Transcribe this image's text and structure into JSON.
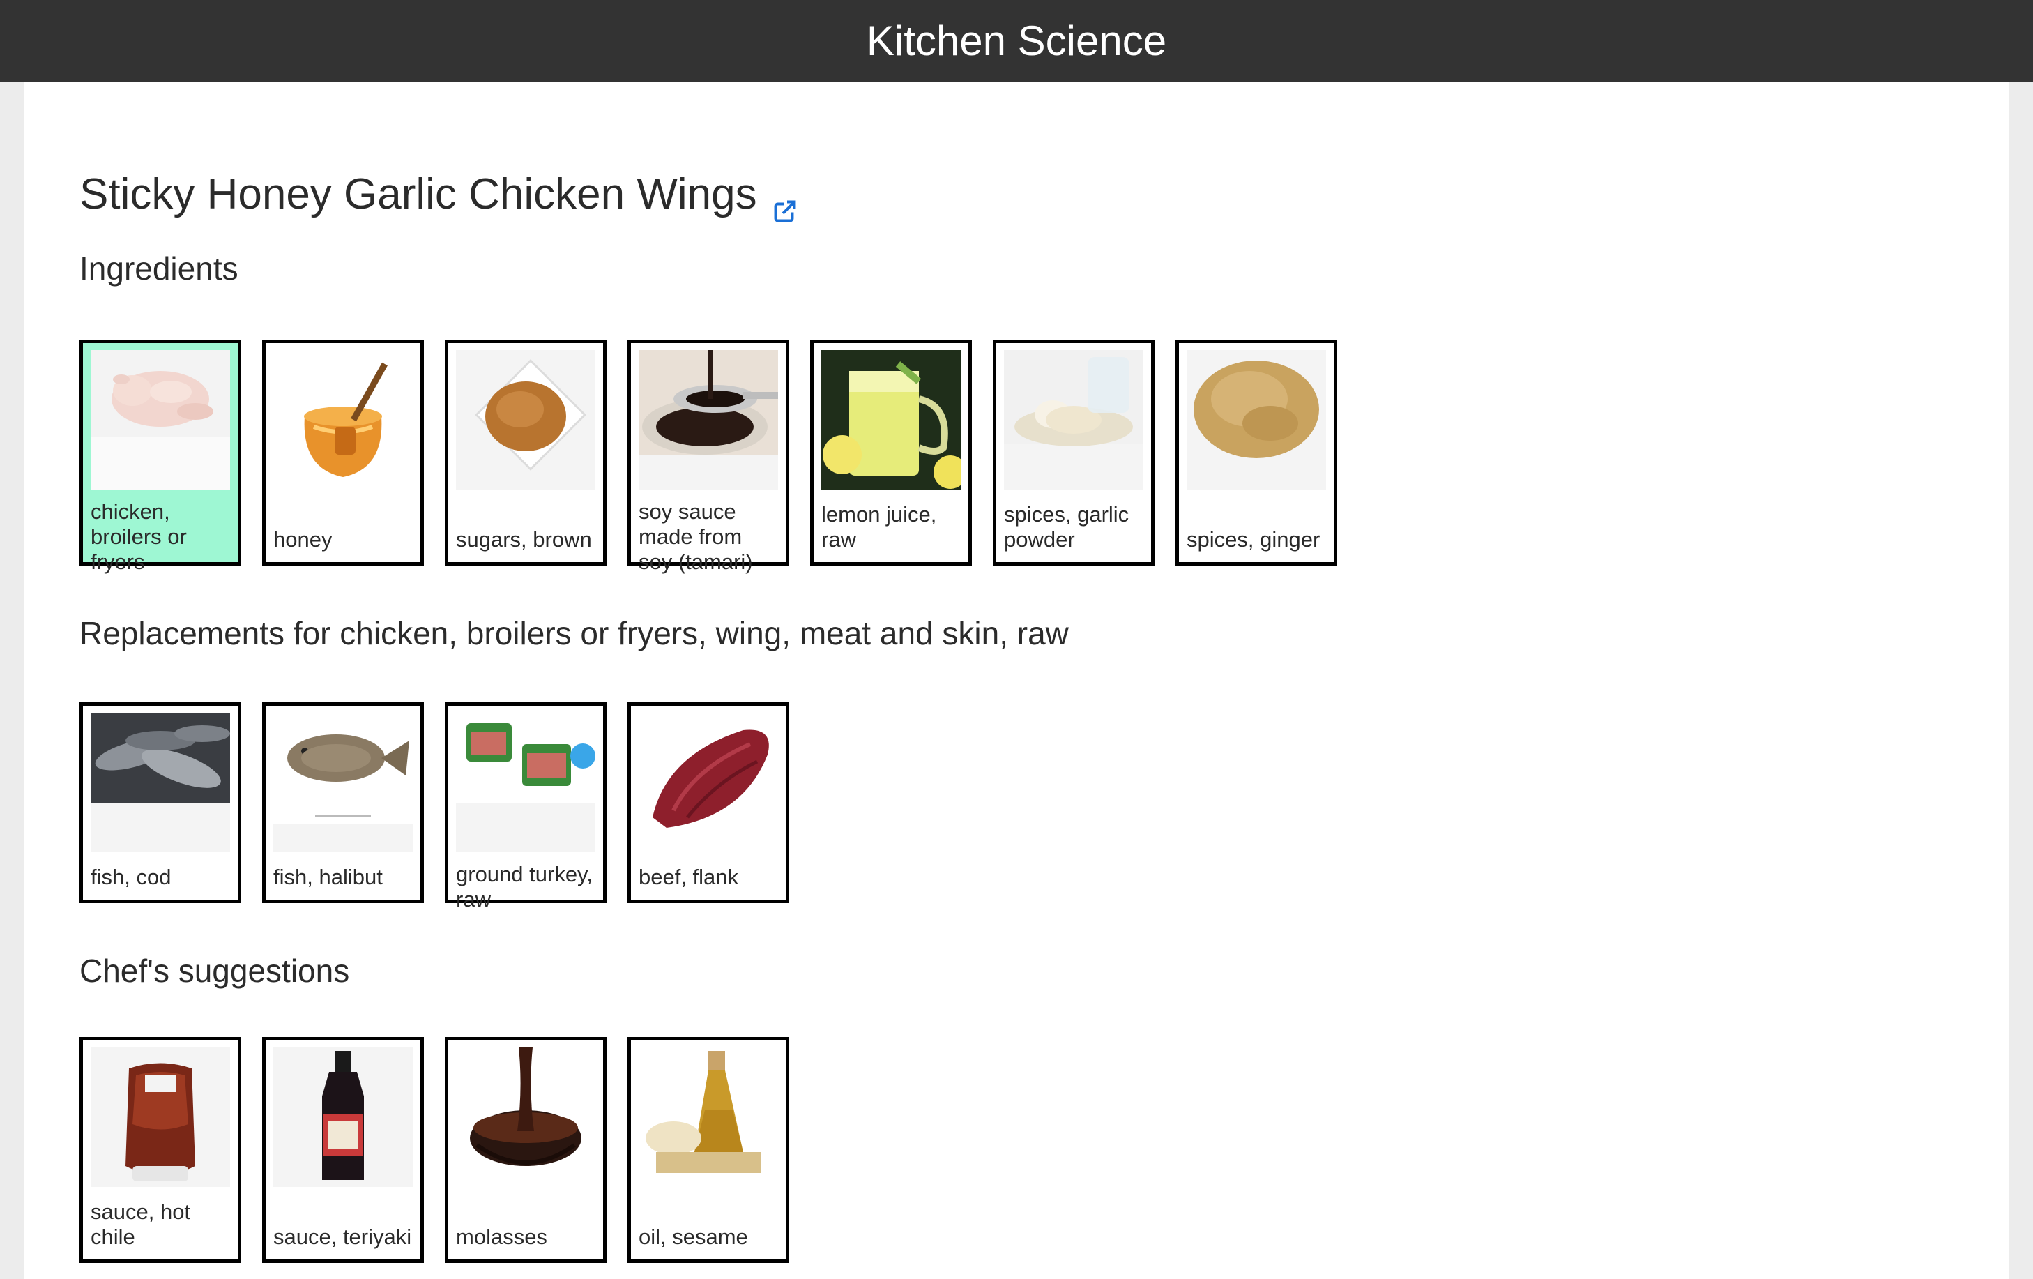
{
  "app": {
    "title": "Kitchen Science"
  },
  "recipe": {
    "title": "Sticky Honey Garlic Chicken Wings",
    "link_icon": "external-link-icon"
  },
  "ingredients": {
    "heading": "Ingredients",
    "items": [
      {
        "label": "chicken, broilers or fryers",
        "icon": "raw-chicken",
        "highlighted": true
      },
      {
        "label": "honey",
        "icon": "honey-jar"
      },
      {
        "label": "sugars, brown",
        "icon": "brown-sugar-bowl"
      },
      {
        "label": "soy sauce made from soy (tamari)",
        "icon": "soy-sauce-spoon"
      },
      {
        "label": "lemon juice, raw",
        "icon": "lemon-juice-glass"
      },
      {
        "label": "spices, garlic powder",
        "icon": "garlic-powder"
      },
      {
        "label": "spices, ginger",
        "icon": "ginger-powder"
      }
    ]
  },
  "replacements": {
    "heading": "Replacements for chicken, broilers or fryers, wing, meat and skin, raw",
    "items": [
      {
        "label": "fish, cod",
        "icon": "cod-fish"
      },
      {
        "label": "fish, halibut",
        "icon": "halibut-fish"
      },
      {
        "label": "ground turkey, raw",
        "icon": "ground-turkey-packs"
      },
      {
        "label": "beef, flank",
        "icon": "flank-steak"
      }
    ]
  },
  "suggestions": {
    "heading": "Chef's suggestions",
    "items": [
      {
        "label": "sauce, hot chile",
        "icon": "sriracha-bottle"
      },
      {
        "label": "sauce, teriyaki",
        "icon": "teriyaki-bottle"
      },
      {
        "label": "molasses",
        "icon": "molasses-bowl"
      },
      {
        "label": "oil, sesame",
        "icon": "sesame-oil-bottle"
      }
    ]
  },
  "colors": {
    "topbar": "#333333",
    "highlight": "#9ef7d3",
    "link": "#1a6fd6",
    "card_border": "#000000"
  }
}
